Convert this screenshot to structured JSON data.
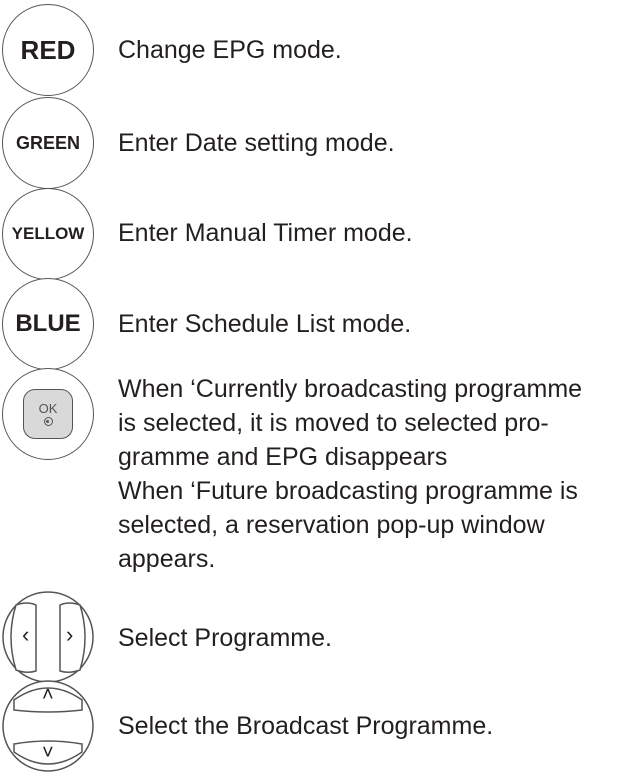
{
  "keys": {
    "red": {
      "label": "RED",
      "description": "Change EPG mode."
    },
    "green": {
      "label": "GREEN",
      "description": "Enter Date setting mode."
    },
    "yellow": {
      "label": "YELLOW",
      "description": "Enter Manual Timer mode."
    },
    "blue": {
      "label": "BLUE",
      "description": "Enter Schedule List mode."
    }
  },
  "ok": {
    "label": "OK",
    "lines": [
      "When ‘Currently broadcasting programme",
      "is selected, it is moved to selected pro-",
      "gramme and EPG disappears",
      "When ‘Future broadcasting programme is",
      "selected, a reservation pop-up window",
      "appears."
    ]
  },
  "left_right": {
    "description": "Select Programme.",
    "left_glyph": "‹",
    "right_glyph": "›"
  },
  "up_down": {
    "description": "Select the Broadcast Programme.",
    "up_glyph": "˄",
    "down_glyph": "˅"
  }
}
